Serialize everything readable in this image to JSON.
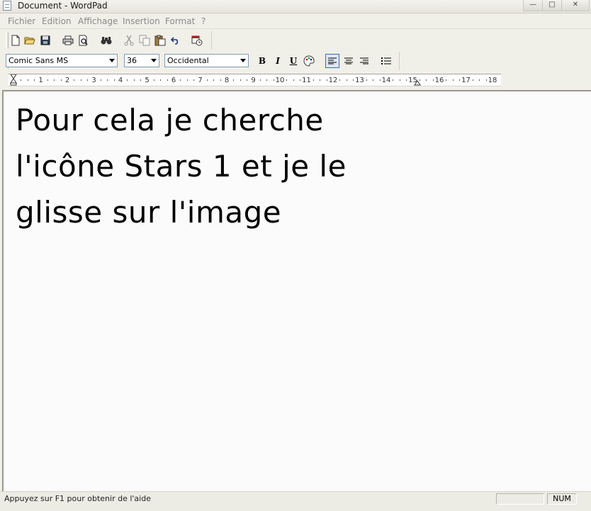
{
  "window": {
    "title": "Document - WordPad"
  },
  "menu": {
    "items": [
      "Fichier",
      "Edition",
      "Affichage",
      "Insertion",
      "Format",
      "?"
    ]
  },
  "format_toolbar": {
    "font_family": "Comic Sans MS",
    "font_size": "36",
    "script": "Occidental",
    "bold": "B",
    "italic": "I",
    "underline": "U"
  },
  "ruler": {
    "marks": [
      "1",
      "2",
      "3",
      "4",
      "5",
      "6",
      "7",
      "8",
      "9",
      "10",
      "11",
      "12",
      "13",
      "14",
      "15",
      "16",
      "17",
      "18"
    ]
  },
  "document": {
    "lines": [
      "Pour cela je cherche",
      "l'icône Stars 1 et je le",
      "glisse sur l'image"
    ]
  },
  "status": {
    "help_text": "Appuyez sur F1 pour obtenir de l'aide",
    "num_indicator": "NUM"
  }
}
